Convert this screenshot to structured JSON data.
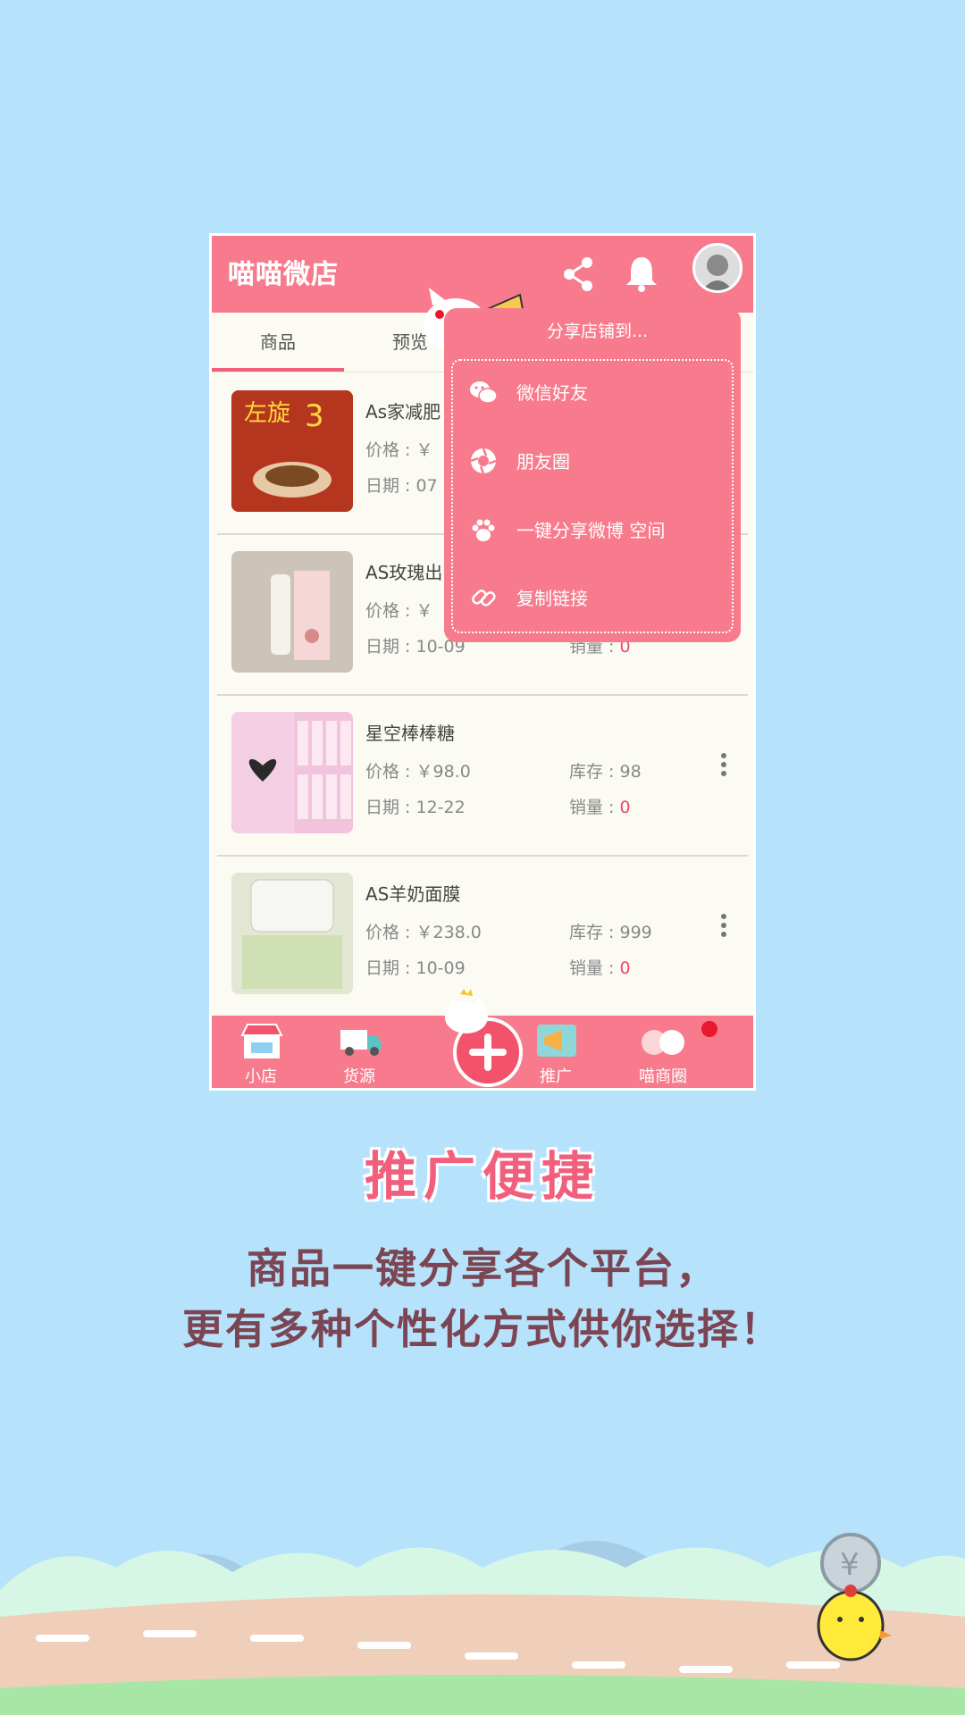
{
  "app": {
    "logo_text": "喵喵微店"
  },
  "tabs": [
    {
      "label": "商品"
    },
    {
      "label": "预览"
    }
  ],
  "share_popup": {
    "title": "分享店铺到...",
    "items": [
      {
        "label": "微信好友",
        "icon": "wechat-icon"
      },
      {
        "label": "朋友圈",
        "icon": "moments-icon"
      },
      {
        "label": "一键分享微博 空间",
        "icon": "paw-icon"
      },
      {
        "label": "复制链接",
        "icon": "link-icon"
      }
    ]
  },
  "products": [
    {
      "title": "As家减肥",
      "price_label": "价格 : ￥",
      "date_label": "日期 : 07",
      "stock_label": "",
      "sales_label": "",
      "sales_value": ""
    },
    {
      "title": "AS玫瑰出",
      "price_label": "价格 : ￥",
      "date_label": "日期 : 10-09",
      "stock_label": "",
      "sales_label": "销量 :",
      "sales_value": "0"
    },
    {
      "title": "星空棒棒糖",
      "price_label": "价格 : ￥98.0",
      "date_label": "日期 : 12-22",
      "stock_label": "库存 : 98",
      "sales_label": "销量 :",
      "sales_value": "0"
    },
    {
      "title": "AS羊奶面膜",
      "price_label": "价格 : ￥238.0",
      "date_label": "日期 : 10-09",
      "stock_label": "库存 : 999",
      "sales_label": "销量 :",
      "sales_value": "0"
    }
  ],
  "bottom_nav": [
    {
      "label": "小店",
      "icon": "shop-icon"
    },
    {
      "label": "货源",
      "icon": "truck-icon"
    },
    {
      "label": "",
      "icon": "plus-icon"
    },
    {
      "label": "推广",
      "icon": "megaphone-icon"
    },
    {
      "label": "喵商圈",
      "icon": "cats-icon"
    }
  ],
  "promo": {
    "headline": "推广便捷",
    "line1": "商品一键分享各个平台，",
    "line2": "更有多种个性化方式供你选择！"
  },
  "colors": {
    "background": "#b6e3fb",
    "brand_pink": "#f77b8c",
    "accent_red": "#f0476a",
    "text_dark": "#7b4553"
  }
}
